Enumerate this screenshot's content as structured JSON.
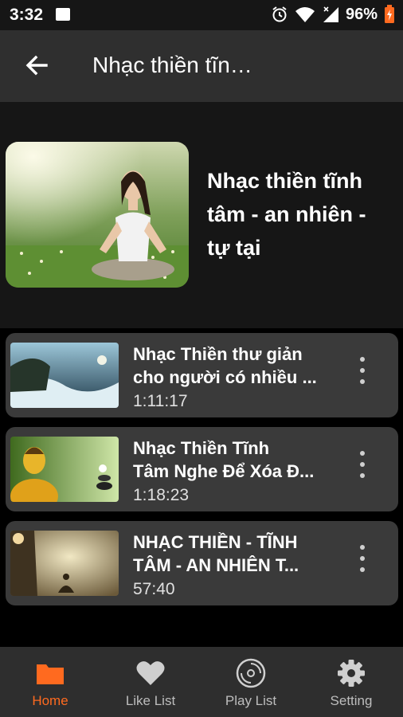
{
  "status_bar": {
    "time": "3:32",
    "battery_percent": "96%",
    "icons": [
      "image-icon",
      "alarm-icon",
      "wifi-icon",
      "signal-icon",
      "battery-icon"
    ]
  },
  "app_bar": {
    "title": "Nhạc thiền tĩn…",
    "back_icon": "arrow-left-icon"
  },
  "playlist": {
    "title_lines": [
      "Nhạc thiền tĩnh",
      "tâm - an nhiên -",
      "tự tại"
    ]
  },
  "videos": [
    {
      "title_lines": [
        "Nhạc Thiền thư giản",
        "cho người có nhiều ..."
      ],
      "duration": "1:11:17"
    },
    {
      "title_lines": [
        "Nhạc Thiền Tĩnh",
        "Tâm Nghe Để Xóa Đ..."
      ],
      "duration": "1:18:23"
    },
    {
      "title_lines": [
        "NHẠC THIỀN - TĨNH",
        "TÂM - AN NHIÊN T..."
      ],
      "duration": "57:40"
    }
  ],
  "bottom_nav": [
    {
      "label": "Home",
      "icon": "folder-icon",
      "active": true
    },
    {
      "label": "Like List",
      "icon": "heart-icon",
      "active": false
    },
    {
      "label": "Play List",
      "icon": "disc-icon",
      "active": false
    },
    {
      "label": "Setting",
      "icon": "gear-icon",
      "active": false
    }
  ],
  "colors": {
    "accent": "#ff6a1f",
    "app_bar": "#2f2f2f",
    "card": "#3a3a3a",
    "bottom_bar": "#2e2e2e"
  }
}
